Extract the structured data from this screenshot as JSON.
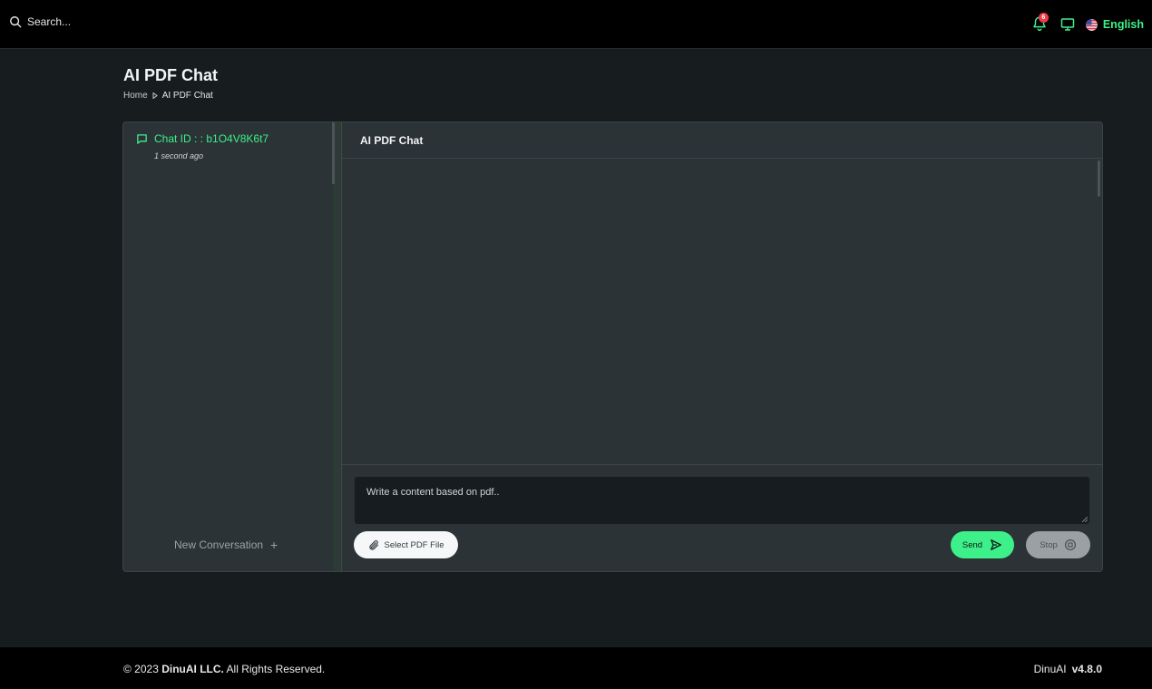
{
  "topbar": {
    "search_label": "Search...",
    "notification_count": "6",
    "language": "English"
  },
  "page": {
    "title": "AI PDF Chat",
    "breadcrumb": {
      "home": "Home",
      "current": "AI PDF Chat"
    }
  },
  "sidebar": {
    "chat_title": "Chat ID : : b1O4V8K6t7",
    "chat_time": "1 second ago",
    "new_conversation": "New Conversation"
  },
  "chat": {
    "header_title": "AI PDF Chat",
    "input_placeholder": "Write a content based on pdf..",
    "select_pdf_label": "Select PDF File",
    "send_label": "Send",
    "stop_label": "Stop"
  },
  "footer": {
    "copyright_prefix": "© 2023",
    "company": "DinuAI LLC.",
    "rights": "All Rights Reserved.",
    "product": "DinuAI",
    "version": "v4.8.0"
  },
  "colors": {
    "accent": "#3ef08a",
    "background": "#171c1f",
    "card": "#2b3336",
    "badge": "#ef3b47"
  }
}
